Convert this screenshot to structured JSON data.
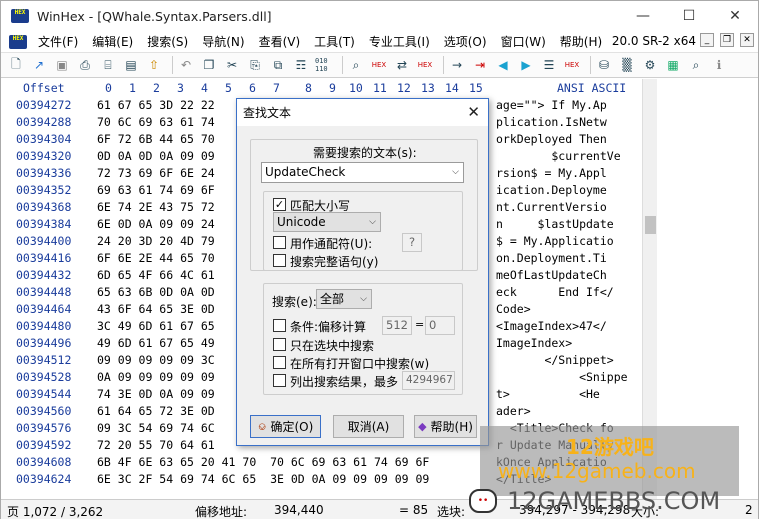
{
  "window": {
    "title": "WinHex - [QWhale.Syntax.Parsers.dll]",
    "app_icon": "HEX",
    "version": "20.0 SR-2 x64"
  },
  "menu": [
    "文件(F)",
    "编辑(E)",
    "搜索(S)",
    "导航(N)",
    "查看(V)",
    "工具(T)",
    "专业工具(I)",
    "选项(O)",
    "窗口(W)",
    "帮助(H)"
  ],
  "toolbar_icons": [
    "new-file-icon",
    "open-icon",
    "save-icon",
    "print-icon",
    "properties-icon",
    "print-preview-icon",
    "export-icon",
    "undo-icon",
    "copy-icon",
    "cut-icon",
    "paste-icon",
    "paste-special-icon",
    "write-icon",
    "binary-icon",
    "find-icon",
    "find-hex-icon",
    "replace-icon",
    "replace-hex-icon",
    "goto-icon",
    "goto-offset-icon",
    "back-icon",
    "forward-icon",
    "list-icon",
    "disk-icon",
    "ram-icon",
    "hash-icon",
    "calculator-icon",
    "search-icon",
    "info-icon"
  ],
  "toolbar_hex_labels": [
    "HEX",
    "HEX",
    "010\n110",
    "HEX"
  ],
  "hex": {
    "offset_header": "Offset",
    "col_headers": [
      "0",
      "1",
      "2",
      "3",
      "4",
      "5",
      "6",
      "7",
      "8",
      "9",
      "10",
      "11",
      "12",
      "13",
      "14",
      "15"
    ],
    "ascii_header": "ANSI ASCII",
    "offsets": [
      "00394272",
      "00394288",
      "00394304",
      "00394320",
      "00394336",
      "00394352",
      "00394368",
      "00394384",
      "00394400",
      "00394416",
      "00394432",
      "00394448",
      "00394464",
      "00394480",
      "00394496",
      "00394512",
      "00394528",
      "00394544",
      "00394560",
      "00394576",
      "00394592",
      "00394608",
      "00394624"
    ],
    "rows": [
      "61 67 65 3D 22 22",
      "70 6C 69 63 61 74",
      "6F 72 6B 44 65 70",
      "0D 0A 0D 0A 09 09",
      "72 73 69 6F 6E 24",
      "69 63 61 74 69 6F",
      "6E 74 2E 43 75 72",
      "6E 0D 0A 09 09 24",
      "24 20 3D 20 4D 79",
      "6F 6E 2E 44 65 70",
      "6D 65 4F 66 4C 61",
      "65 63 6B 0D 0A 0D",
      "43 6F 64 65 3E 0D",
      "3C 49 6D 61 67 65",
      "49 6D 61 67 65 49",
      "09 09 09 09 09 3C",
      "0A 09 09 09 09 09",
      "74 3E 0D 0A 09 09",
      "61 64 65 72 3E 0D",
      "09 3C 54 69 74 6C",
      "72 20 55 70 64 61",
      "6B 4F 6E 63 65 20 41 70  70 6C 69 63 61 74 69 6F",
      "6E 3C 2F 54 69 74 6C 65  3E 0D 0A 09 09 09 09 09"
    ],
    "ascii": [
      "age=\"\"> If My.Ap",
      "plication.IsNetw",
      "orkDeployed Then",
      "        $currentVe",
      "rsion$ = My.Appl",
      "ication.Deployme",
      "nt.CurrentVersio",
      "n     $lastUpdate",
      "$ = My.Applicatio",
      "on.Deployment.Ti",
      "meOfLastUpdateCh",
      "eck      End If</",
      "Code>",
      "<ImageIndex>47</",
      "ImageIndex>",
      "       </Snippet>",
      "            <Snippe",
      "t>          <He",
      "ader>",
      "  <Title>Check fo",
      "r Update Manually",
      "kOnce Applicatio",
      "</Title>"
    ]
  },
  "dialog": {
    "title": "查找文本",
    "prompt": "需要搜索的文本(s):",
    "search_text": "UpdateCheck",
    "match_case": "匹配大小写",
    "encoding": "Unicode",
    "wildcards": "用作通配符(U):",
    "wildcard_char": "?",
    "whole_words": "搜索完整语句(y)",
    "search_label": "搜索(e):",
    "search_scope": "全部",
    "cond_offset": "条件:偏移计算",
    "cond_val1": "512",
    "cond_eq": "=",
    "cond_val2": "0",
    "only_selection": "只在选块中搜索",
    "all_windows": "在所有打开窗口中搜索(w)",
    "list_results": "列出搜索结果，最多",
    "max_results": "4294967",
    "ok": "确定(O)",
    "cancel": "取消(A)",
    "help": "帮助(H)"
  },
  "status": {
    "page": "页 1,072 / 3,262",
    "offset_label": "偏移地址:",
    "offset_value": "394,440",
    "eq_value": "= 85",
    "block_label": "选块:",
    "block_value": "394,297 - 394,298",
    "size_label": "大小:",
    "size_value": "2"
  },
  "watermark": {
    "cn": "12游戏吧",
    "url": "www.12gameb.com",
    "brand": "12GAMEBBS.COM"
  }
}
